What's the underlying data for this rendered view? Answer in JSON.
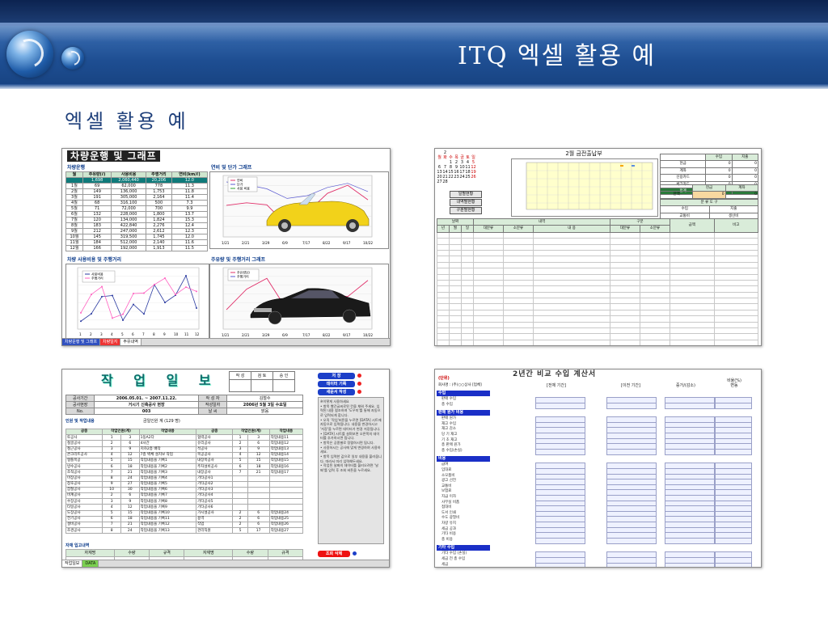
{
  "header": {
    "title": "ITQ 엑셀 활용 예"
  },
  "subtitle": "엑셀 활용 예",
  "shot1": {
    "title": "차량운행 및 그래프",
    "section_table": "차량운행",
    "section_chart1": "연비 및 단가 그래프",
    "section_chart2": "차량 사용비용 및 주행거리",
    "section_chart3": "주유량 및 주행거리 그래프",
    "table_headers": [
      "월",
      "주유량(ℓ)",
      "사용비용",
      "주행거리",
      "연비(km/ℓ)"
    ],
    "table_rows": [
      [
        "",
        "1,698",
        "2,060,440",
        "20,206",
        "12.0"
      ],
      [
        "1월",
        "69",
        "62,000",
        "778",
        "11.3"
      ],
      [
        "2월",
        "149",
        "136,000",
        "1,753",
        "11.8"
      ],
      [
        "3월",
        "191",
        "305,000",
        "2,164",
        "11.4"
      ],
      [
        "4월",
        "68",
        "316,100",
        "500",
        "7.3"
      ],
      [
        "5월",
        "71",
        "72,000",
        "700",
        "9.9"
      ],
      [
        "6월",
        "132",
        "228,000",
        "1,800",
        "13.7"
      ],
      [
        "7월",
        "120",
        "134,000",
        "1,824",
        "15.3"
      ],
      [
        "8월",
        "183",
        "422,840",
        "2,276",
        "12.4"
      ],
      [
        "9월",
        "212",
        "247,000",
        "2,612",
        "12.3"
      ],
      [
        "10월",
        "145",
        "319,500",
        "1,745",
        "12.0"
      ],
      [
        "11월",
        "184",
        "512,000",
        "2,140",
        "11.6"
      ],
      [
        "12월",
        "166",
        "192,000",
        "1,913",
        "11.5"
      ]
    ],
    "legend1": [
      "연비",
      "단가",
      "사용 비용"
    ],
    "legend2": [
      "사용비용",
      "주행거리"
    ],
    "legend3": [
      "주유량(ℓ)",
      "주행거리"
    ],
    "x_ticks1": [
      "1/21",
      "2/21",
      "3/29",
      "6/9",
      "7/17",
      "8/22",
      "9/17",
      "10/22"
    ],
    "x_ticks2": [
      "1",
      "2",
      "3",
      "4",
      "5",
      "6",
      "7",
      "8",
      "9",
      "10",
      "11",
      "12"
    ],
    "tabs": [
      "차량운행 및 그래프",
      "차량일지",
      "주유내역"
    ]
  },
  "shot2": {
    "title": "2월 금전출납부",
    "buttons": [
      "일별현황",
      "내역별현황",
      "구분별현황"
    ],
    "summary_headers": [
      "",
      "수입",
      "지출"
    ],
    "summary_rows": [
      "현금",
      "계좌",
      "신용카드",
      "체크카드",
      "합계"
    ],
    "box2_headers": [
      "",
      "현금",
      "계좌"
    ],
    "box2_row": "잔액",
    "box3_header": "분 류 도 구",
    "box3_rows": [
      [
        "수입",
        "지출"
      ],
      [
        "교통비",
        "생산비"
      ]
    ],
    "ledger_headers": [
      "년",
      "월",
      "일",
      "대분류",
      "소분류",
      "내 용",
      "대분류",
      "소분류",
      "금액",
      "비고"
    ],
    "group_headers": [
      "날짜",
      "내역",
      "구분"
    ]
  },
  "shot3": {
    "title": "작 업 일 보",
    "approve": [
      "작 성",
      "검 토",
      "승 인"
    ],
    "info_rows": [
      [
        "공사기간",
        "2006.05.01. ~ 2007.11.22.",
        "작 성 자",
        "김철수"
      ],
      [
        "공사현장",
        "거시기 신축공사 현장",
        "작성일자",
        "2006년 5월 3일 수요일"
      ],
      [
        "No.",
        "003",
        "날 씨",
        "맑음"
      ]
    ],
    "section_work": "인원 및 작업내용",
    "total_label": "금일인원 계 (129 명)",
    "work_headers": [
      "공종",
      "작업인원(계)",
      "작업내용",
      "공종",
      "작업인원(계)",
      "작업내용"
    ],
    "work_rows": [
      [
        "토공사",
        "1",
        "3",
        "1동A2다",
        "협력공사",
        "1",
        "3",
        "작업내용11"
      ],
      [
        "철골공사",
        "2",
        "6",
        "4사간",
        "유리공사",
        "2",
        "6",
        "작업내용12"
      ],
      [
        "철근공사",
        "3",
        "9",
        "지하2층 배작",
        "석공사",
        "3",
        "9",
        "작업내용13"
      ],
      [
        "콘크리트공사",
        "4",
        "12",
        "7층 벽체 설치보 작업",
        "목공공사",
        "4",
        "12",
        "작업내용14"
      ],
      [
        "형틀목공",
        "5",
        "15",
        "작업내용을 기록1",
        "내장목공사",
        "5",
        "15",
        "작업내용15"
      ],
      [
        "방수공사",
        "6",
        "18",
        "작업내용을 기록2",
        "주차설비공사",
        "6",
        "18",
        "작업내용16"
      ],
      [
        "조적공사",
        "7",
        "21",
        "작업내용을 기록3",
        "내장공사",
        "7",
        "21",
        "작업내용17"
      ],
      [
        "미장공사",
        "8",
        "24",
        "작업내용을 기록4",
        "기타공사1",
        "",
        "",
        ""
      ],
      [
        "창호공사",
        "9",
        "27",
        "작업내용을 기록5",
        "기타공사2",
        "",
        "",
        ""
      ],
      [
        "잡철공사",
        "10",
        "30",
        "작업내용을 기록6",
        "기타공사3",
        "",
        "",
        ""
      ],
      [
        "비계공사",
        "2",
        "6",
        "작업내용을 기록7",
        "기타공사4",
        "",
        "",
        ""
      ],
      [
        "수장공사",
        "3",
        "9",
        "작업내용을 기록8",
        "기타공사5",
        "",
        "",
        ""
      ],
      [
        "타일공사",
        "4",
        "12",
        "작업내용을 기록9",
        "기타공사6",
        "",
        "",
        ""
      ],
      [
        "도장공사",
        "5",
        "15",
        "작업내용을 기록10",
        "가시설공사",
        "2",
        "6",
        "작업내용24"
      ],
      [
        "전기공사",
        "6",
        "18",
        "작업내용을 기록11",
        "용역",
        "2",
        "6",
        "작업내용25"
      ],
      [
        "설비공사",
        "7",
        "21",
        "작업내용을 기록12",
        "작업",
        "2",
        "6",
        "작업내용26"
      ],
      [
        "조경공사",
        "8",
        "24",
        "작업내용을 기록13",
        "관리직원",
        "5",
        "17",
        "작업내용27"
      ]
    ],
    "section_material": "자재 입고내역",
    "material_headers": [
      "자재명",
      "수량",
      "규격",
      "자재명",
      "수량",
      "규격"
    ],
    "buttons": [
      "저 장",
      "데이터 기록",
      "새문서 작성"
    ],
    "delete_button": "조회 삭제",
    "side_text": "※이렇게 사용하세요\n• 항목 빨간글씨로된 칸을 채워 주세요. 입력된 내용 참조하여 '도우미'를 통해 자동으로 입력되게 합니다.\n• 오직 '작업'버튼을 누르면 [DATA] 시트에 자동으로 입력됩니다. 내용을 변경하시고 '저장'을 누르면 데이터가 변경 저장됩니다.\n• [DATA] 시트를 살펴보면 오른쪽의 데이터를 추가하시면 됩니다.\n• 항목은 공종별로 정렬하시면 됩니다.\n• 사용하시는 공사에 맞게 변경하여 사용하세요.\n• 항목 입력한 값으로 일부 내용을 불러옵니다. 따라서 미리 입력해두세요.\n• 작업된 날짜의 데이터를 불러오려면 '날짜'를 입력 후 조회 버튼을 누르세요.",
    "tabs": [
      "작업일보",
      "DATA"
    ]
  },
  "shot4": {
    "title": "2년간 비교 수입 계산서",
    "unit": "(단위)",
    "company_line": "회사명 :   (주)○○상사 [업체]",
    "col_headers": [
      "[전체 기간]",
      "[이전 기간]",
      "증가/(감소)",
      "비율(%)\n변동"
    ],
    "sections": [
      "수입",
      "판매 원가 비용",
      "비용",
      "기타 수입"
    ],
    "income_rows": [
      "판매 수입",
      "총 수입"
    ],
    "cost_rows": [
      "판매 원가",
      "재고 수입",
      "재고 감소",
      "당 기 재고",
      "기 초 재고",
      "총 판매 원가",
      "총 수입(손실)"
    ],
    "expense_rows": [
      "급여",
      "임대료",
      "소모품비",
      "광고 선전",
      "교통비",
      "보험료",
      "지급 이자",
      "사무실 비품",
      "접대비",
      "도서 인쇄",
      "수도 광열비",
      "차량 유지",
      "세금 공과",
      "기타 비용",
      "총 비용"
    ],
    "other_rows": [
      "기타 수입 (손실)",
      "세금 전 총 수입",
      "세금",
      "총 수입(손실)"
    ],
    "section_colors": {
      "header": "#1a2fc7",
      "cell": "#eef1ff"
    }
  }
}
